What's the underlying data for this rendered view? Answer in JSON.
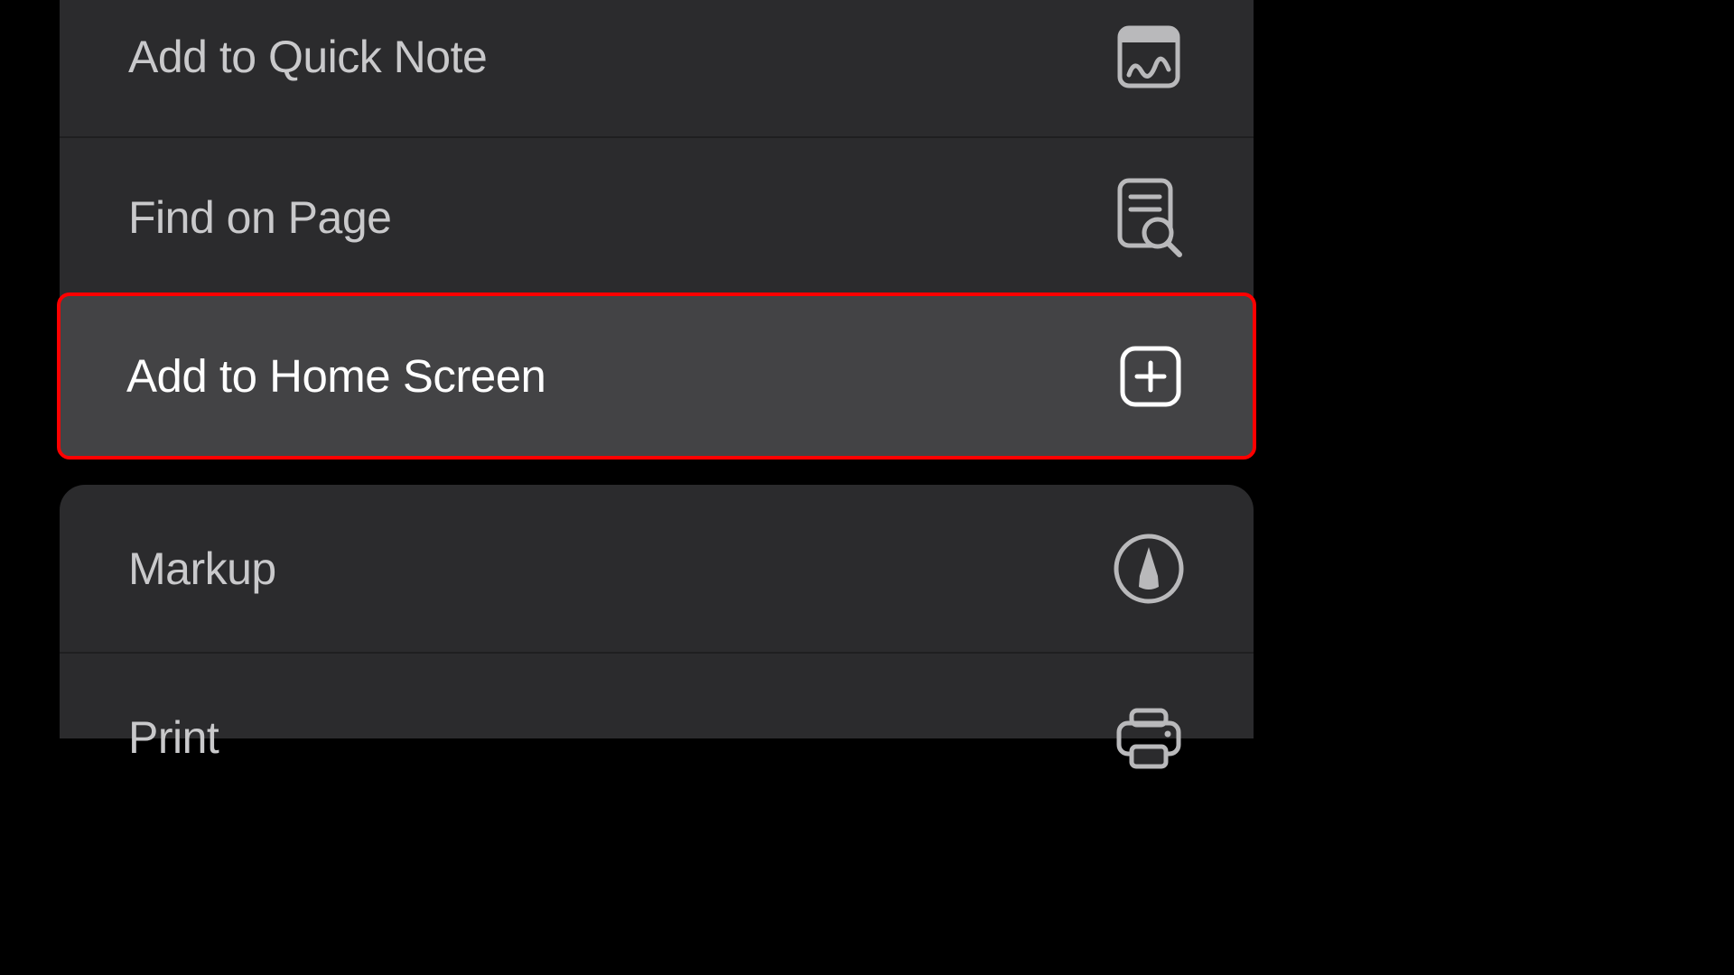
{
  "menu": {
    "items": [
      {
        "label": "Add to Quick Note",
        "icon": "quick-note-icon"
      },
      {
        "label": "Find on Page",
        "icon": "find-on-page-icon"
      },
      {
        "label": "Add to Home Screen",
        "icon": "add-square-icon",
        "highlighted": true
      },
      {
        "label": "Markup",
        "icon": "markup-icon"
      },
      {
        "label": "Print",
        "icon": "printer-icon"
      }
    ]
  },
  "colors": {
    "background": "#000000",
    "cell_bg": "#2b2b2d",
    "highlight_bg": "#434345",
    "text_dim": "#c9c9cb",
    "text_bright": "#ffffff",
    "highlight_border": "#ff0000"
  }
}
